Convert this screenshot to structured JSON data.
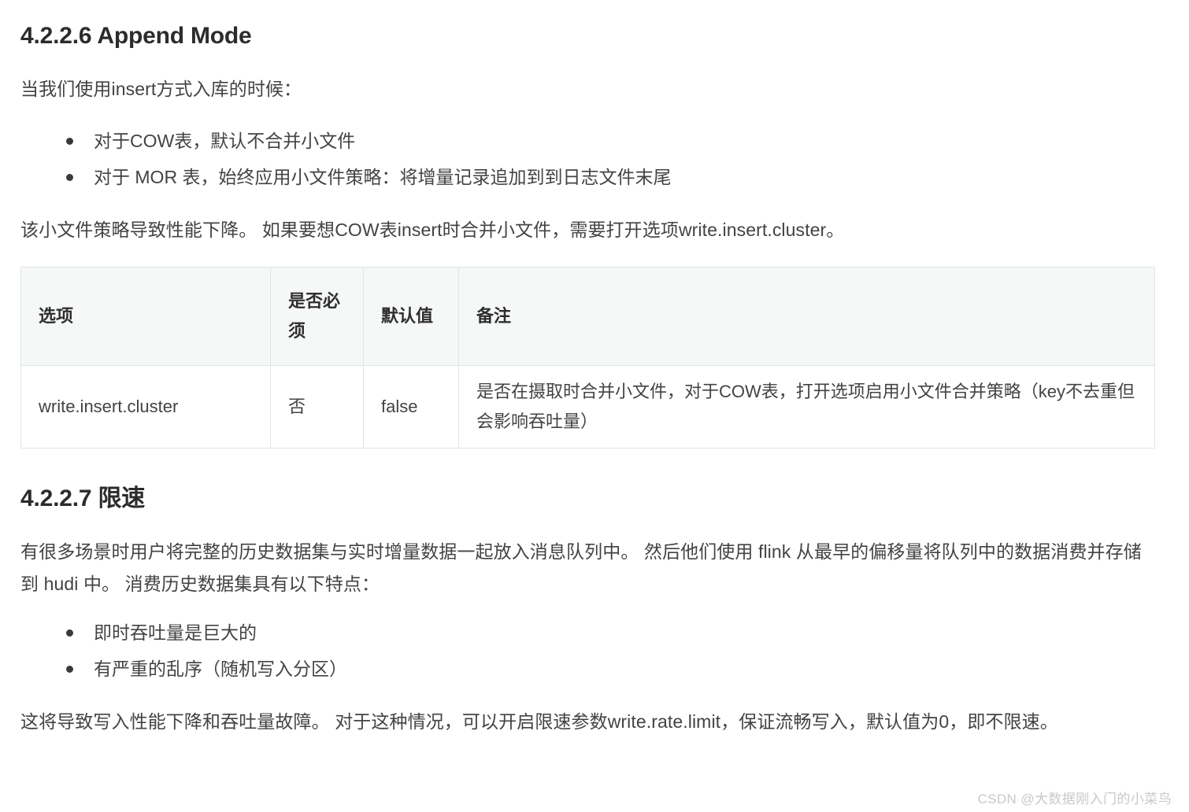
{
  "document": {
    "sections": [
      {
        "heading": "4.2.2.6 Append Mode",
        "intro": "当我们使用insert方式入库的时候：",
        "bullets": [
          "对于COW表，默认不合并小文件",
          "对于 MOR 表，始终应用小文件策略：将增量记录追加到到日志文件末尾"
        ],
        "note": "该小文件策略导致性能下降。 如果要想COW表insert时合并小文件，需要打开选项write.insert.cluster。"
      },
      {
        "heading": "4.2.2.7 限速",
        "intro": "有很多场景时用户将完整的历史数据集与实时增量数据一起放入消息队列中。 然后他们使用 flink 从最早的偏移量将队列中的数据消费并存储到 hudi 中。 消费历史数据集具有以下特点：",
        "bullets": [
          "即时吞吐量是巨大的",
          "有严重的乱序（随机写入分区）"
        ],
        "note": "这将导致写入性能下降和吞吐量故障。 对于这种情况，可以开启限速参数write.rate.limit，保证流畅写入，默认值为0，即不限速。"
      }
    ],
    "table": {
      "headers": [
        "选项",
        "是否必须",
        "默认值",
        "备注"
      ],
      "rows": [
        {
          "option": "write.insert.cluster",
          "required": "否",
          "default": "false",
          "remark": "是否在摄取时合并小文件，对于COW表，打开选项启用小文件合并策略（key不去重但会影响吞吐量）"
        }
      ]
    },
    "watermark": "CSDN @大数据刚入门的小菜鸟",
    "colors": {
      "heading": "#2c2c2c",
      "body": "#434343",
      "table_border": "#dfe5e9",
      "table_header_bg": "#f6f8f8",
      "watermark": "#c9c9c9"
    }
  }
}
